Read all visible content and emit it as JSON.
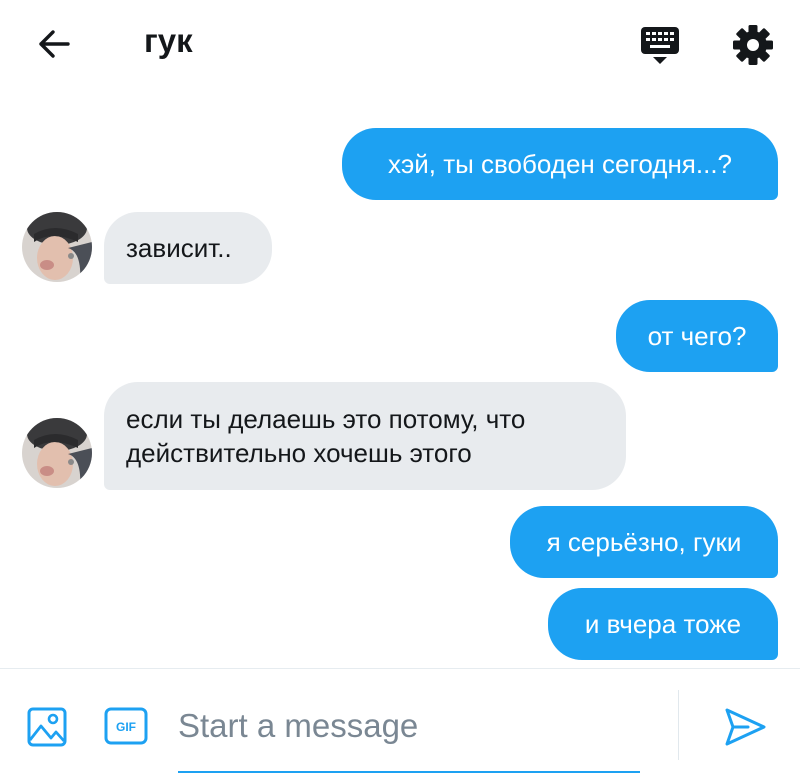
{
  "header": {
    "title": "гук",
    "back_icon": "arrow-left-icon",
    "dm_icon": "keyboard-icon",
    "settings_icon": "gear-icon"
  },
  "messages": [
    {
      "direction": "out",
      "text": "хэй, ты свободен сегодня...?"
    },
    {
      "direction": "in",
      "text": "зависит.."
    },
    {
      "direction": "out",
      "text": "от чего?"
    },
    {
      "direction": "in",
      "text": "если ты делаешь это потому, что действительно хочешь этого"
    },
    {
      "direction": "out",
      "text": "я серьёзно, гуки"
    },
    {
      "direction": "out",
      "text": "и вчера тоже"
    }
  ],
  "composer": {
    "placeholder": "Start a message",
    "gif_label": "GIF",
    "image_icon": "image-icon",
    "send_icon": "send-icon"
  },
  "colors": {
    "accent": "#1da1f2",
    "incoming_bubble": "#e8ebee",
    "text": "#14171a",
    "placeholder": "#7a8793"
  }
}
